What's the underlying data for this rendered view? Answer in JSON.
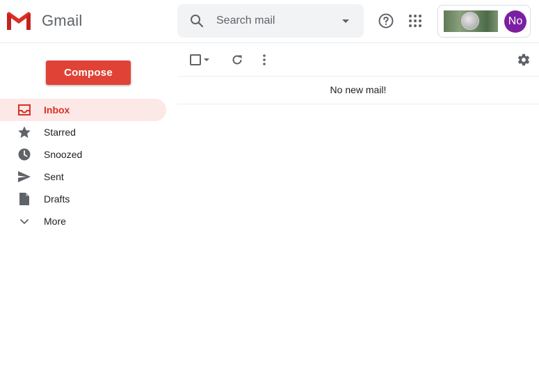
{
  "app": {
    "brand": "Gmail"
  },
  "search": {
    "placeholder": "Search mail"
  },
  "account": {
    "avatar_initials": "No",
    "avatar_color": "#7b1fa2"
  },
  "compose": {
    "label": "Compose",
    "color": "#e04336"
  },
  "sidebar": {
    "items": [
      {
        "label": "Inbox",
        "icon": "inbox-icon",
        "active": true
      },
      {
        "label": "Starred",
        "icon": "star-icon"
      },
      {
        "label": "Snoozed",
        "icon": "clock-icon"
      },
      {
        "label": "Sent",
        "icon": "send-icon"
      },
      {
        "label": "Drafts",
        "icon": "draft-icon"
      },
      {
        "label": "More",
        "icon": "chevron-down-icon"
      }
    ]
  },
  "toolbar": {
    "icons": [
      "checkbox-icon",
      "caret-down-icon",
      "refresh-icon",
      "more-vert-icon",
      "gear-icon"
    ]
  },
  "mail_list": {
    "empty_message": "No new mail!"
  },
  "colors": {
    "accent": "#d93025",
    "active_bg": "#fce8e6"
  }
}
